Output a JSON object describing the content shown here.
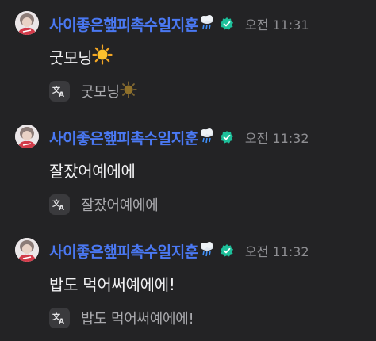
{
  "messages": [
    {
      "author": "사이좋은햎피촉수일지훈",
      "timestamp": "오전 11:31",
      "text": "굿모닝",
      "text_emoji": "sun-emoji",
      "translated": "굿모닝",
      "translated_emoji": "sun-emoji"
    },
    {
      "author": "사이좋은햎피촉수일지훈",
      "timestamp": "오전 11:32",
      "text": "잘잤어예에에",
      "text_emoji": "",
      "translated": "잘잤어예에에",
      "translated_emoji": ""
    },
    {
      "author": "사이좋은햎피촉수일지훈",
      "timestamp": "오전 11:32",
      "text": "밥도 먹어써예에에!",
      "text_emoji": "",
      "translated": "밥도 먹어써예에에!",
      "translated_emoji": ""
    }
  ],
  "icons": {
    "author_emoji": "rain-cloud-emoji",
    "verified": "verified-badge-icon",
    "translate": "translate-icon"
  },
  "colors": {
    "background": "#232325",
    "author": "#4a78f2",
    "verified_badge": "#1dbf9a",
    "timestamp": "#8e8e92",
    "text": "#f0f0f2",
    "translated_text": "#a9a9ad"
  }
}
